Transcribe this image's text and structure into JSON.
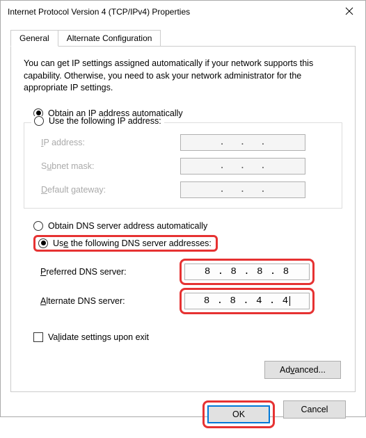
{
  "window": {
    "title": "Internet Protocol Version 4 (TCP/IPv4) Properties"
  },
  "tabs": {
    "general": "General",
    "alternate": "Alternate Configuration"
  },
  "intro": "You can get IP settings assigned automatically if your network supports this capability. Otherwise, you need to ask your network administrator for the appropriate IP settings.",
  "ip": {
    "auto_label_pre": "O",
    "auto_label_rest": "btain an IP address automatically",
    "manual_label_pre": "Use the following IP address:",
    "ip_address": "IP address:",
    "ip_address_u": "I",
    "subnet": "Subnet mask:",
    "subnet_u": "u",
    "gateway": "Default gateway:",
    "gateway_u": "D"
  },
  "dns": {
    "auto_label_pre": "O",
    "auto_label_rest": "btain DNS server address automatically",
    "manual_label_pre": "Use the following DNS server addresses:",
    "manual_u": "e",
    "preferred": "Preferred DNS server:",
    "preferred_u": "P",
    "alternate": "Alternate DNS server:",
    "alternate_u": "A",
    "preferred_value": "8 . 8 . 8 . 8",
    "alternate_value": "8 . 8 . 4 . 4"
  },
  "validate": {
    "label_pre": "Va",
    "label_u": "l",
    "label_rest": "idate settings upon exit"
  },
  "buttons": {
    "advanced_pre": "Ad",
    "advanced_u": "v",
    "advanced_rest": "anced...",
    "ok": "OK",
    "cancel": "Cancel"
  }
}
